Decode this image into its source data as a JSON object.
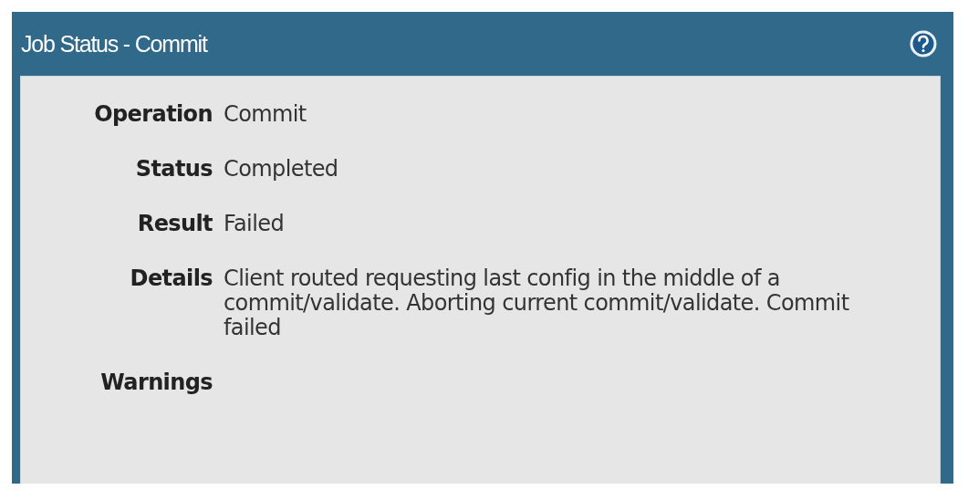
{
  "window": {
    "title": "Job Status - Commit"
  },
  "fields": [
    {
      "label": "Operation",
      "value": "Commit"
    },
    {
      "label": "Status",
      "value": "Completed"
    },
    {
      "label": "Result",
      "value": "Failed"
    },
    {
      "label": "Details",
      "value": "Client routed requesting last config in the middle of a commit/validate. Aborting current commit/validate. Commit failed"
    },
    {
      "label": "Warnings"
    }
  ]
}
